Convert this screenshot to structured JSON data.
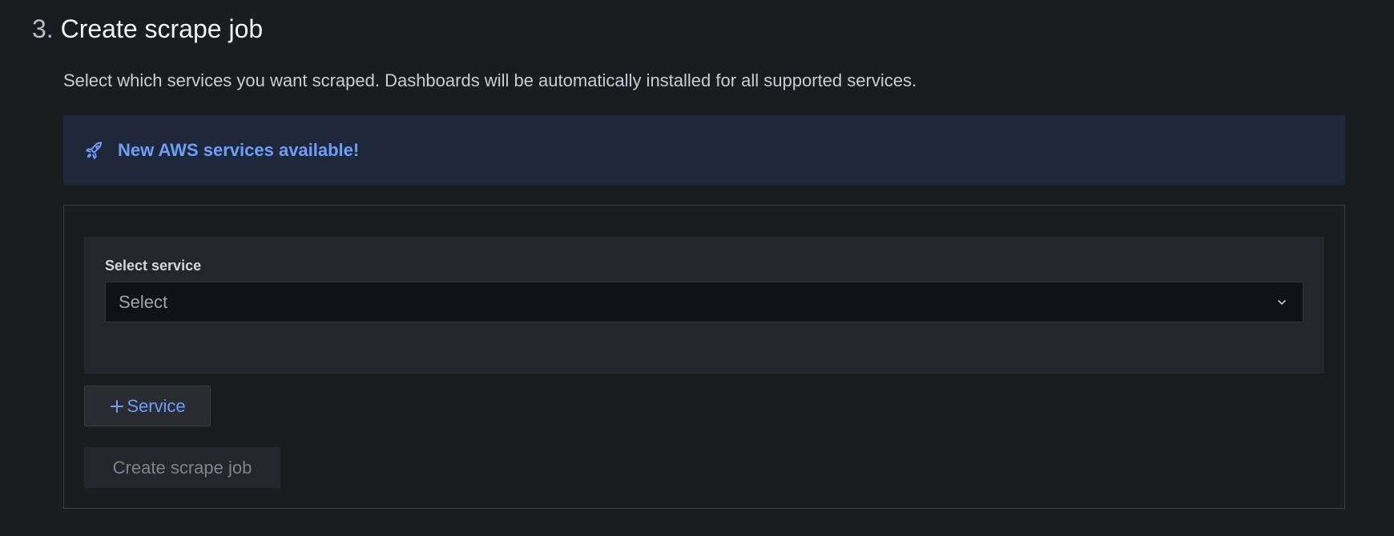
{
  "step": {
    "number": "3.",
    "title": "Create scrape job"
  },
  "description": "Select which services you want scraped. Dashboards will be automatically installed for all supported services.",
  "banner": {
    "icon": "rocket-icon",
    "text": "New AWS services available!",
    "background": "#1f283b",
    "text_color": "#6e9ef6"
  },
  "service_form": {
    "label": "Select service",
    "select_placeholder": "Select",
    "chevron_icon": "chevron-down-icon"
  },
  "add_service_button": {
    "icon": "plus-icon",
    "label": "Service"
  },
  "create_button": {
    "label": "Create scrape job",
    "state": "disabled"
  },
  "colors": {
    "page_background": "#1b1c20",
    "accent": "#6e9ef6"
  }
}
